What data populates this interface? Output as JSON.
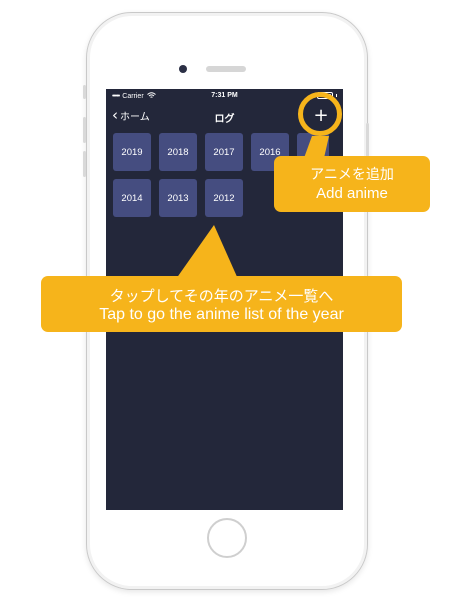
{
  "status_bar": {
    "carrier": "Carrier",
    "time": "7:31 PM"
  },
  "nav": {
    "back_label": "ホーム",
    "title": "ログ",
    "add_symbol": "+"
  },
  "years": {
    "row1": [
      "2019",
      "2018",
      "2017",
      "2016"
    ],
    "row2": [
      "2014",
      "2013",
      "2012"
    ]
  },
  "annotations": {
    "add_anime_jp": "アニメを追加",
    "add_anime_en": "Add anime",
    "tap_year_jp": "タップしてその年のアニメ一覧へ",
    "tap_year_en": "Tap to go the anime list of the year"
  },
  "colors": {
    "screen_background": "#23273a",
    "tile": "#454d80",
    "callout": "#f6b41b"
  }
}
